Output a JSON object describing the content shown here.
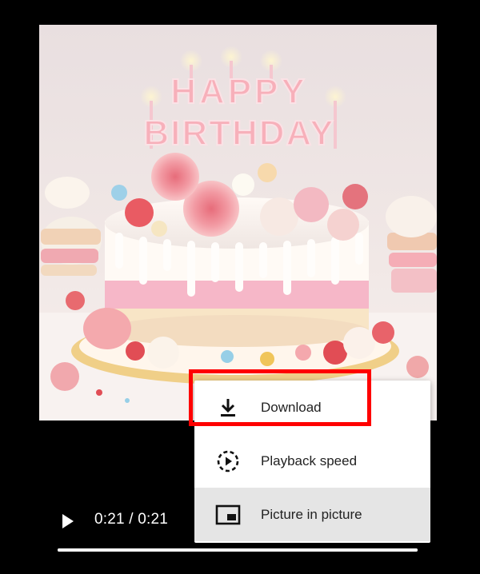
{
  "video": {
    "cake_text": "HAPPY BIRTHDAY"
  },
  "controls": {
    "time": "0:21 / 0:21",
    "progress_fraction": 1.0
  },
  "menu": {
    "items": [
      {
        "label": "Download",
        "icon": "download-icon"
      },
      {
        "label": "Playback speed",
        "icon": "playback-speed-icon"
      },
      {
        "label": "Picture in picture",
        "icon": "picture-in-picture-icon"
      }
    ],
    "hovered_index": 2,
    "highlighted_index": 0
  },
  "colors": {
    "highlight": "#ff0000",
    "menu_hover": "#e5e5e5",
    "background": "#000000"
  }
}
